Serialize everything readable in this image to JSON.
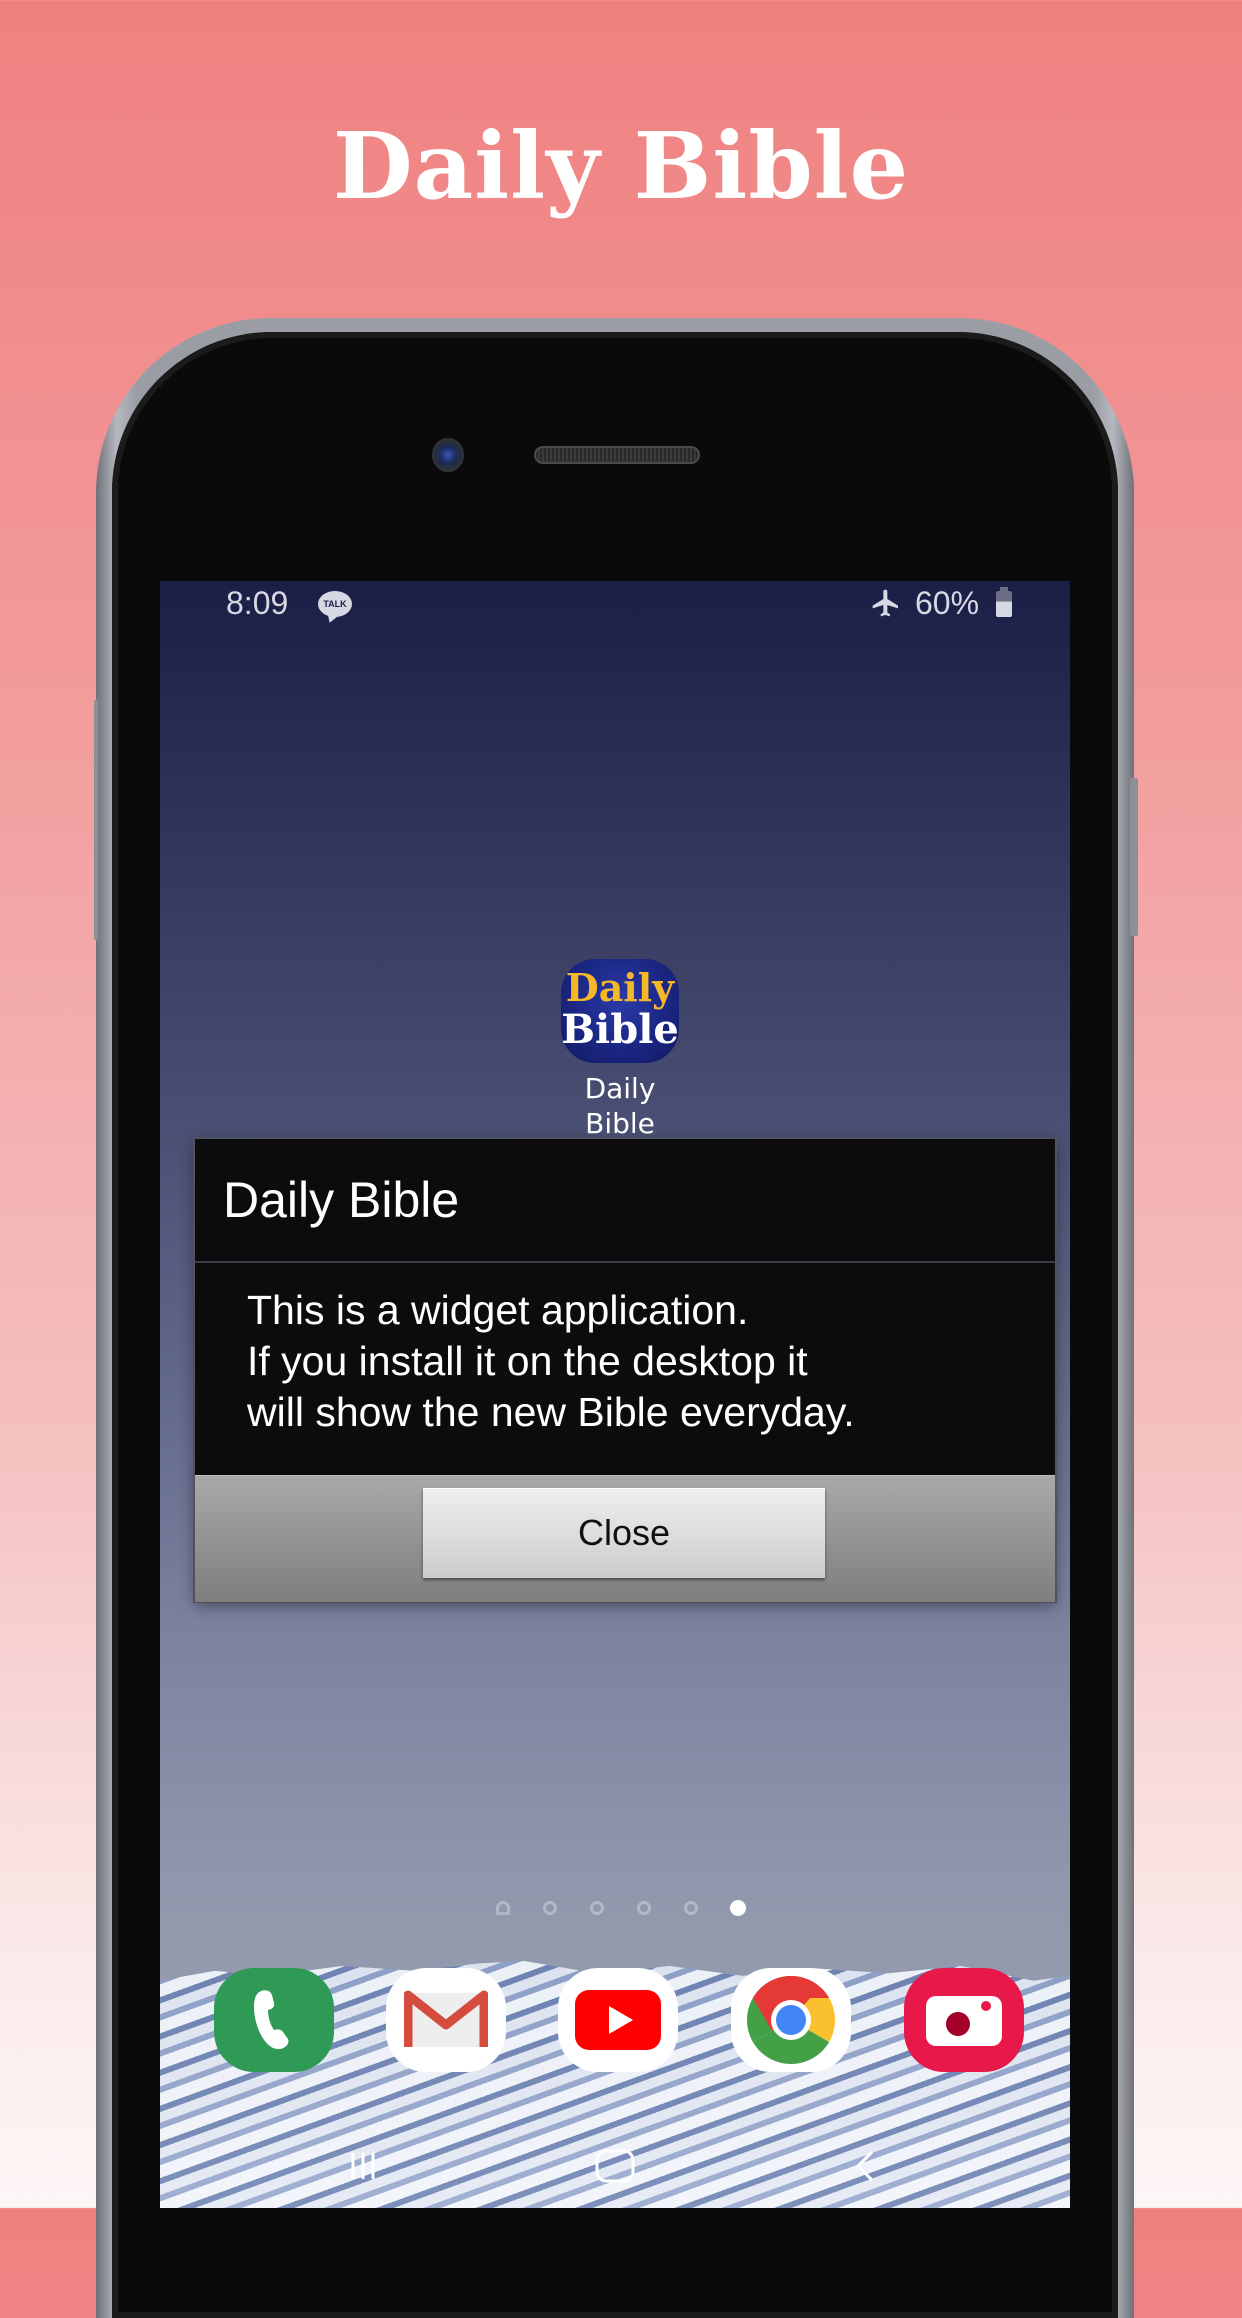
{
  "promo": {
    "title": "Daily Bible",
    "background_top": "#f08080",
    "background_bottom": "#fdf6f6"
  },
  "status_bar": {
    "time": "8:09",
    "notification_icon": "kakaotalk-icon",
    "notification_label": "TALK",
    "airplane_mode_icon": "airplane-icon",
    "battery_percent": "60%",
    "battery_level": 0.6
  },
  "home_screen": {
    "app_shortcut": {
      "icon_text_line1": "Daily",
      "icon_text_line2": "Bible",
      "label": "Daily\nBible",
      "icon_colors": {
        "background": "#1a2580",
        "line1": "#f5b82a",
        "line2": "#ffffff"
      }
    },
    "page_indicator": {
      "pages": 6,
      "home_page_index": 0,
      "active_page_index": 5
    },
    "dock": [
      {
        "name": "phone",
        "icon": "phone-icon",
        "color": "#2e9a55"
      },
      {
        "name": "gmail",
        "icon": "gmail-icon",
        "color": "#ffffff"
      },
      {
        "name": "youtube",
        "icon": "youtube-icon",
        "color": "#ffffff"
      },
      {
        "name": "chrome",
        "icon": "chrome-icon",
        "color": "#ffffff"
      },
      {
        "name": "camera",
        "icon": "camera-icon",
        "color": "#e8194a"
      }
    ],
    "nav_bar": [
      {
        "name": "recents",
        "icon": "recent-apps-icon"
      },
      {
        "name": "home",
        "icon": "home-icon"
      },
      {
        "name": "back",
        "icon": "back-icon"
      }
    ]
  },
  "dialog": {
    "title": "Daily Bible",
    "message": "This is a widget application.\nIf you install it on the desktop it\nwill show the new Bible everyday.",
    "close_label": "Close"
  }
}
